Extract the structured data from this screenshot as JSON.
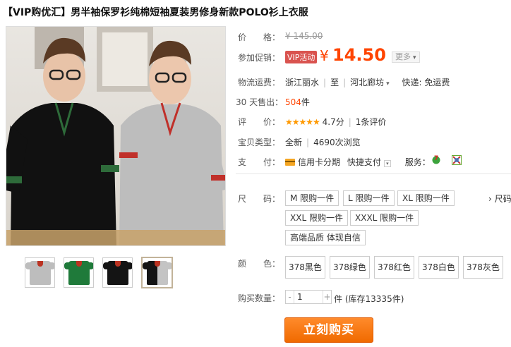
{
  "title": "【VIP购优汇】男半袖保罗衫纯棉短袖夏装男修身新款POLO衫上衣服",
  "price_row": {
    "label": "价　　格：",
    "original": "¥ 145.00"
  },
  "promo_row": {
    "label": "参加促销：",
    "badge": "VIP活动",
    "currency": "¥",
    "price": "14.50",
    "more": "更多"
  },
  "shipping_row": {
    "label": "物流运费：",
    "from": "浙江丽水",
    "to_prefix": "至",
    "to": "河北廊坊",
    "express": "快递: 免运费"
  },
  "sales_row": {
    "label": "30 天售出：",
    "count": "504",
    "unit": "件"
  },
  "rating_row": {
    "label": "评　　价：",
    "stars": "★★★★★",
    "score": "4.7分",
    "reviews": "1条评价"
  },
  "type_row": {
    "label": "宝贝类型：",
    "type": "全新",
    "views": "4690次浏览"
  },
  "payment_row": {
    "label": "支　　付：",
    "credit": "信用卡分期",
    "quick": "快捷支付",
    "service_label": "服务："
  },
  "size_row": {
    "label": "尺　　码：",
    "options": [
      "M 限购一件",
      "L 限购一件",
      "XL 限购一件",
      "XXL 限购一件",
      "XXXL 限购一件",
      "高端品质 体现自信"
    ],
    "size_chart": "› 尺码"
  },
  "color_row": {
    "label": "颜　　色：",
    "options": [
      "378黑色",
      "378绿色",
      "378红色",
      "378白色",
      "378灰色"
    ]
  },
  "quantity_row": {
    "label": "购买数量：",
    "minus": "-",
    "value": "1",
    "plus": "+",
    "unit": "件",
    "stock": "(库存13335件)"
  },
  "buy_button": "立刻购买",
  "colors": {
    "price": "#ff4400",
    "buy_button": "#f06a00",
    "badge": "#d9534f"
  }
}
